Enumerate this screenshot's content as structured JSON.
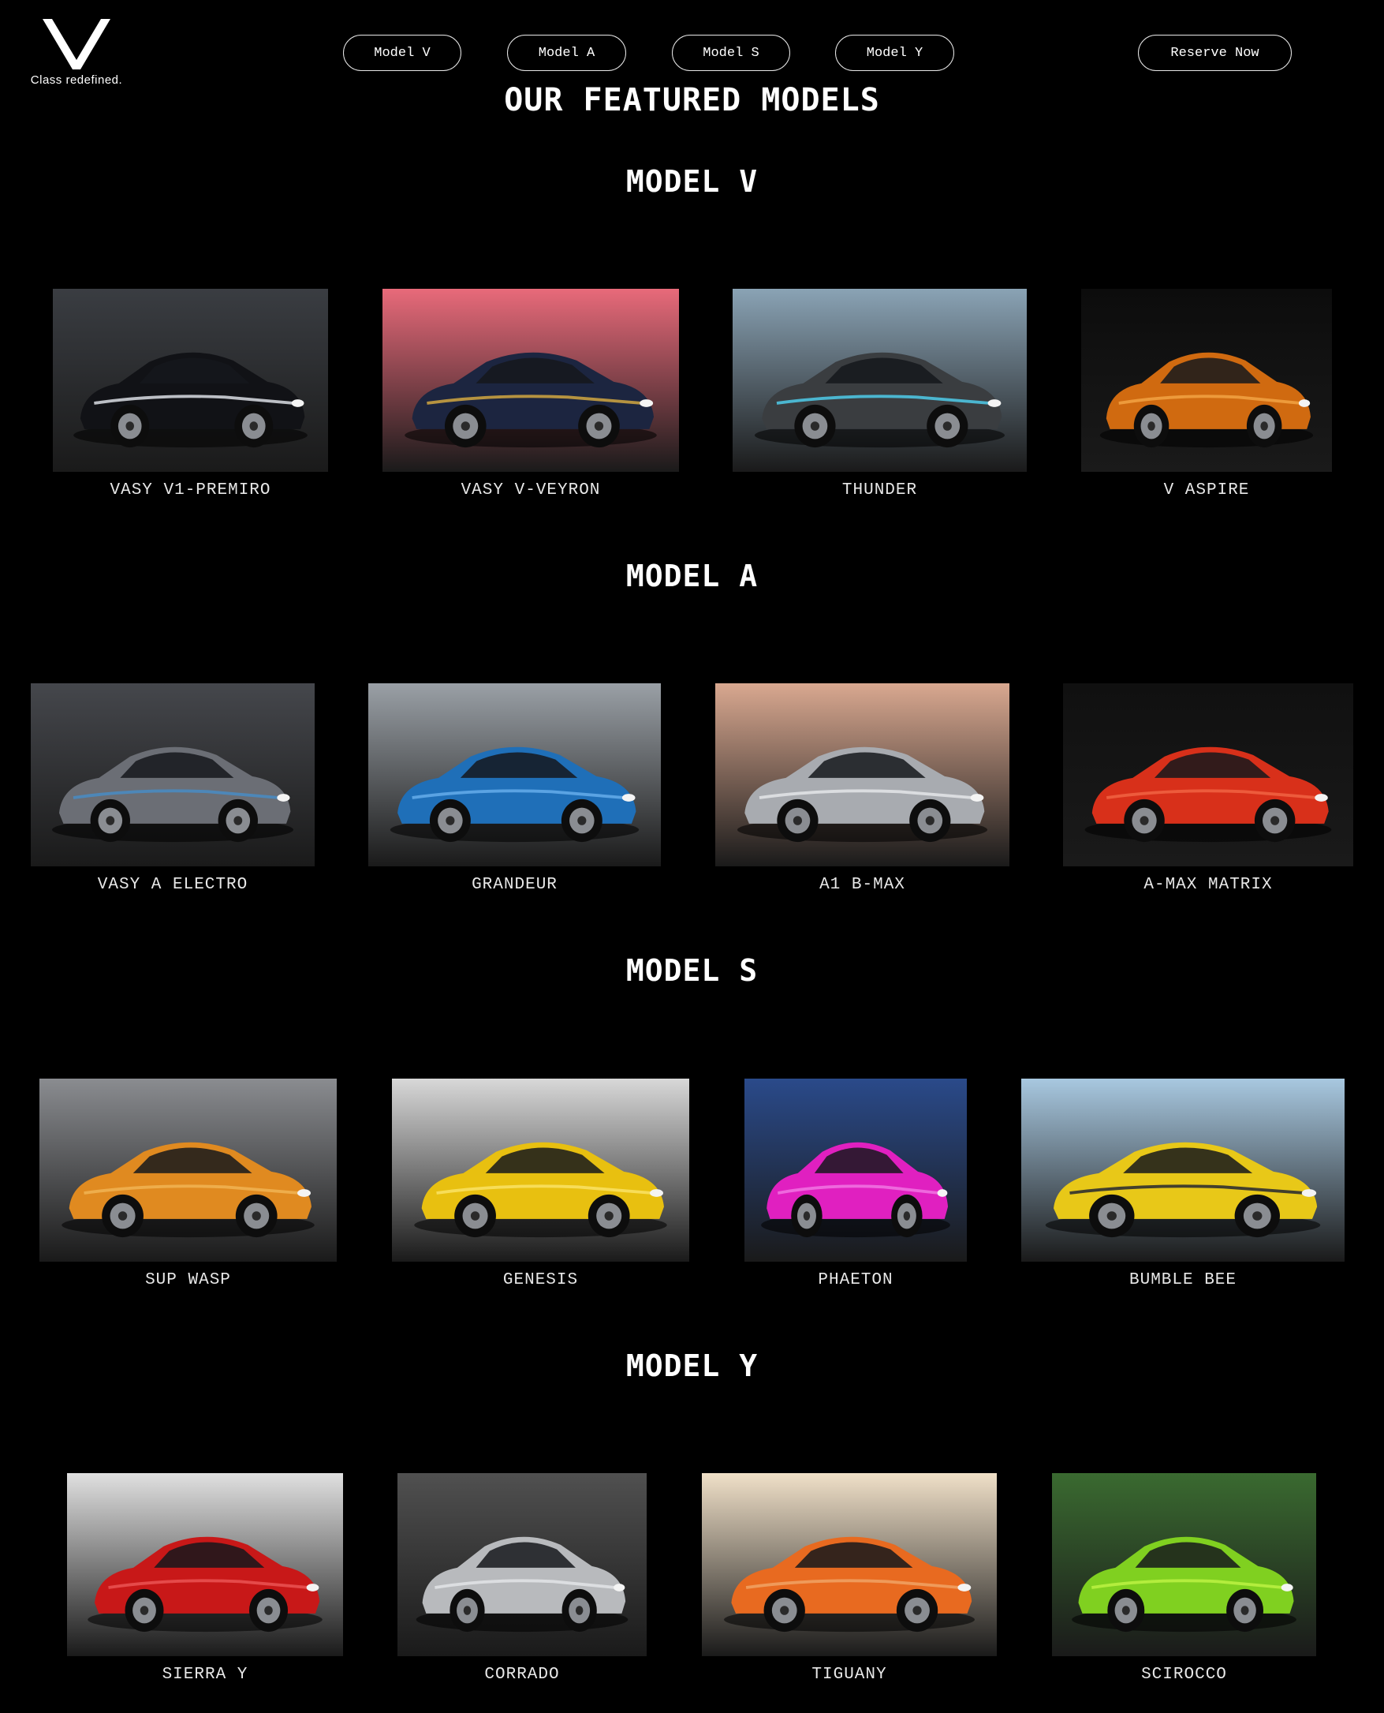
{
  "brand": {
    "logo_letter": "V",
    "tagline": "Class redefined."
  },
  "nav": {
    "items": [
      {
        "label": "Model V"
      },
      {
        "label": "Model A"
      },
      {
        "label": "Model S"
      },
      {
        "label": "Model Y"
      }
    ],
    "cta": "Reserve Now"
  },
  "page_title": "OUR FEATURED MODELS",
  "sections": [
    {
      "title": "MODEL V",
      "cars": [
        {
          "name": "VASY V1-PREMIRO",
          "bg": "#3a3d42",
          "body": "#111216",
          "accent": "#cfd3d8"
        },
        {
          "name": "VASY V-VEYRON",
          "bg": "#e86a7a",
          "body": "#1c2540",
          "accent": "#c8a040"
        },
        {
          "name": "THUNDER",
          "bg": "#8aa3b5",
          "body": "#3a3d40",
          "accent": "#4ec3e0"
        },
        {
          "name": "V ASPIRE",
          "bg": "#0c0c0c",
          "body": "#d06a10",
          "accent": "#f0a040"
        }
      ]
    },
    {
      "title": "MODEL A",
      "cars": [
        {
          "name": "VASY A ELECTRO",
          "bg": "#45474c",
          "body": "#6b6e75",
          "accent": "#4a8ac0"
        },
        {
          "name": "GRANDEUR",
          "bg": "#9aa0a6",
          "body": "#1f6fb8",
          "accent": "#60a8e8"
        },
        {
          "name": "A1 B-MAX",
          "bg": "#d9a890",
          "body": "#a8abb0",
          "accent": "#e0e2e5"
        },
        {
          "name": "A-MAX MATRIX",
          "bg": "#101010",
          "body": "#d8301a",
          "accent": "#f06040"
        }
      ]
    },
    {
      "title": "MODEL S",
      "cars": [
        {
          "name": "SUP WASP",
          "bg": "#8a8c90",
          "body": "#e08a20",
          "accent": "#f0b050"
        },
        {
          "name": "GENESIS",
          "bg": "#d8d8d8",
          "body": "#e8c010",
          "accent": "#f8e060"
        },
        {
          "name": "PHAETON",
          "bg": "#2a4a8a",
          "body": "#e020c0",
          "accent": "#f070e0"
        },
        {
          "name": "BUMBLE BEE",
          "bg": "#a8c8e0",
          "body": "#e8c818",
          "accent": "#303030"
        }
      ]
    },
    {
      "title": "MODEL Y",
      "cars": [
        {
          "name": "SIERRA Y",
          "bg": "#e0e0e0",
          "body": "#c81818",
          "accent": "#e85050"
        },
        {
          "name": "CORRADO",
          "bg": "#505050",
          "body": "#b8babd",
          "accent": "#e0e2e4"
        },
        {
          "name": "TIGUANY",
          "bg": "#f0e0c8",
          "body": "#e86a20",
          "accent": "#f0a060"
        },
        {
          "name": "SCIROCCO",
          "bg": "#3a6a30",
          "body": "#80d020",
          "accent": "#b8f040"
        }
      ]
    }
  ]
}
